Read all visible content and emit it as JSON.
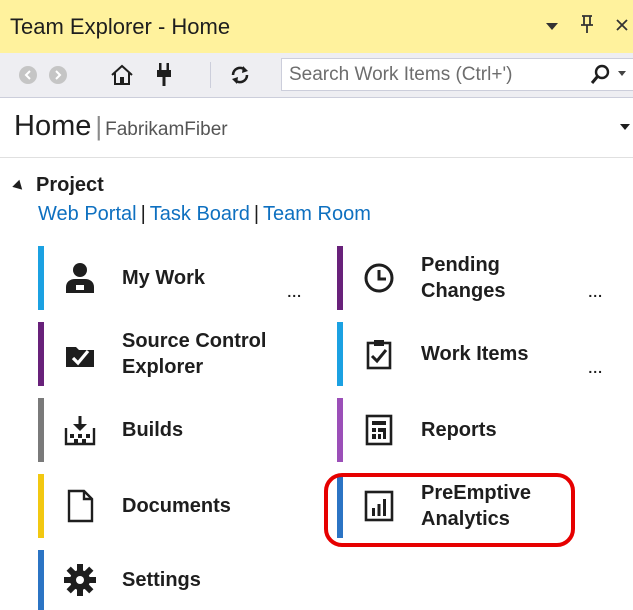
{
  "window": {
    "title": "Team Explorer - Home"
  },
  "title_buttons": {
    "dropdown_icon": "▾",
    "pin_icon": "ᴨ",
    "close_icon": "✕"
  },
  "toolbar": {
    "back_icon": "arrow-back-icon",
    "forward_icon": "arrow-forward-icon",
    "home_icon": "home-icon",
    "connect_icon": "plug-icon",
    "refresh_icon": "refresh-icon"
  },
  "search": {
    "placeholder": "Search Work Items (Ctrl+')"
  },
  "header": {
    "title": "Home",
    "separator": "|",
    "project": "FabrikamFiber"
  },
  "section": {
    "label": "Project",
    "links": [
      "Web Portal",
      "Task Board",
      "Team Room"
    ],
    "link_separator": "|"
  },
  "tiles": {
    "my_work": {
      "label": "My Work",
      "more": "...",
      "accent": "#1ba1e2"
    },
    "pending_changes": {
      "label_line1": "Pending",
      "label_line2": "Changes",
      "more": "...",
      "accent": "#68217a"
    },
    "source_control_explorer": {
      "label_line1": "Source Control",
      "label_line2": "Explorer",
      "accent": "#68217a"
    },
    "work_items": {
      "label": "Work Items",
      "more": "...",
      "accent": "#1ba1e2"
    },
    "builds": {
      "label": "Builds",
      "accent": "#7a7a7a"
    },
    "reports": {
      "label": "Reports",
      "accent": "#9b4fb8"
    },
    "documents": {
      "label": "Documents",
      "accent": "#f2c811"
    },
    "preemptive_analytics": {
      "label_line1": "PreEmptive",
      "label_line2": "Analytics",
      "accent": "#2b74c4"
    },
    "settings": {
      "label": "Settings",
      "accent": "#2b74c4"
    }
  },
  "colors": {
    "titlebar_bg": "#fff29d",
    "toolbar_bg": "#eeeef2",
    "link": "#0e70c0",
    "highlight": "#e60000"
  }
}
